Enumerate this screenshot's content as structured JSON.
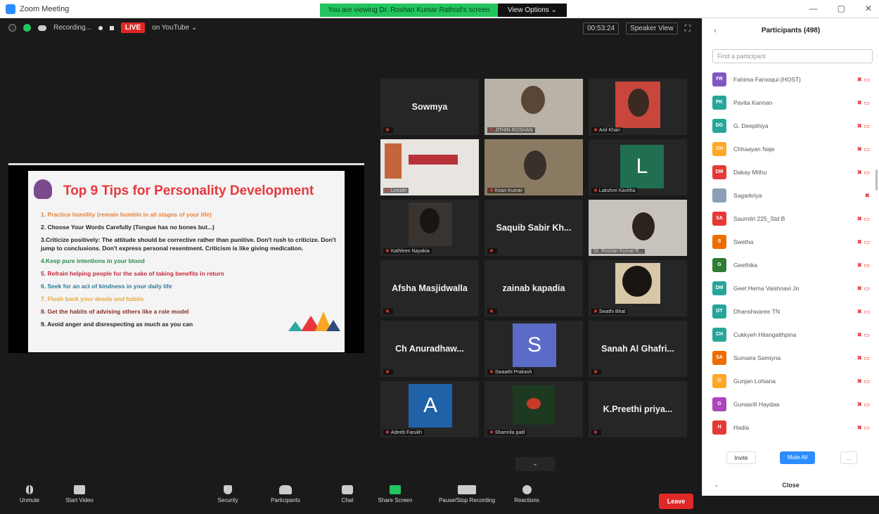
{
  "window": {
    "title": "Zoom Meeting",
    "banner": "You are viewing Dr. Roshan Kumar Rathod's screen",
    "view_options": "View Options ⌄",
    "controls": [
      "—",
      "▢",
      "✕"
    ]
  },
  "topbar": {
    "recording": "Recording...",
    "live": "LIVE",
    "live_on": "on YouTube ⌄",
    "timer": "00:53:24",
    "view": "Speaker View"
  },
  "slide": {
    "title": "Top 9 Tips for Personality Development",
    "items": [
      {
        "text": "1. Practice humility (remain humble in all stages of your life)",
        "color": "#e8833a"
      },
      {
        "text": "2. Choose Your Words Carefully (Tongue has no bones but...)",
        "color": "#222222"
      },
      {
        "text": "3.Criticize positively: The attitude should be corrective rather than punitive. Don't rush to criticize. Don't jump to conclusions. Don't express personal resentment. Criticism is like giving medication.",
        "color": "#222222"
      },
      {
        "text": "4.Keep pure intentions in your blood",
        "color": "#2a8a4a"
      },
      {
        "text": "5. Refrain helping people for the sake of taking benefits in return",
        "color": "#c8283a"
      },
      {
        "text": "6. Seek for an act of kindness in your daily life",
        "color": "#2a7a9a"
      },
      {
        "text": "7. Flush back your deeds and habits",
        "color": "#e8a83a"
      },
      {
        "text": "8. Get the habits of advising others like a role model",
        "color": "#8a2a2a"
      },
      {
        "text": "9. Avoid anger and disrespecting as much as you can",
        "color": "#222222"
      }
    ]
  },
  "tiles": [
    {
      "name": "Sowmya",
      "label": ""
    },
    {
      "name": "",
      "label": "JITHIN ROSHAN"
    },
    {
      "name": "",
      "label": "Anil Khan"
    },
    {
      "name": "",
      "label": "Lincoln"
    },
    {
      "name": "",
      "label": "Kiran Kumar"
    },
    {
      "name": "",
      "label": "Lakshmi Kavitha",
      "letter": "L"
    },
    {
      "name": "",
      "label": "Kathleen Nayakia"
    },
    {
      "name": "Saquib Sabir Kh...",
      "label": ""
    },
    {
      "name": "",
      "label": "Dr. Roshan Kumar R..."
    },
    {
      "name": "Afsha Masjidwalla",
      "label": ""
    },
    {
      "name": "zainab kapadia",
      "label": ""
    },
    {
      "name": "",
      "label": "Swathi Bhat"
    },
    {
      "name": "Ch Anuradhaw...",
      "label": ""
    },
    {
      "name": "",
      "label": "Swaathi Prakash",
      "letter": "S"
    },
    {
      "name": "Sanah Al Ghafri...",
      "label": ""
    },
    {
      "name": "",
      "label": "Adeeb Farukh",
      "letter": "A"
    },
    {
      "name": "",
      "label": "Sharmila patil"
    },
    {
      "name": "K.Preethi priya...",
      "label": ""
    }
  ],
  "more_arrow": "⌄",
  "toolbar": [
    {
      "label": "Unmute",
      "icon": "mic-icon"
    },
    {
      "label": "Start Video",
      "icon": "video-icon"
    },
    {
      "label": "Security",
      "icon": "shield-icon"
    },
    {
      "label": "Participants",
      "icon": "participants-icon",
      "count": "498"
    },
    {
      "label": "Chat",
      "icon": "chat-icon"
    },
    {
      "label": "Share Screen",
      "icon": "share-icon"
    },
    {
      "label": "Pause/Stop Recording",
      "icon": "record-icon"
    },
    {
      "label": "Reactions",
      "icon": "reactions-icon"
    }
  ],
  "leave": "Leave",
  "panel": {
    "title": "Participants (498)",
    "search_placeholder": "Find a participant",
    "participants": [
      {
        "initials": "FR",
        "name": "Fahima Farooqui (HOST)",
        "color": "#7e57c2"
      },
      {
        "initials": "PK",
        "name": "Pavita Kannan",
        "color": "#26a69a"
      },
      {
        "initials": "DG",
        "name": "G. Deepthiya",
        "color": "#26a69a"
      },
      {
        "initials": "CH",
        "name": "Chhaayan Naje",
        "color": "#ffa726"
      },
      {
        "initials": "DM",
        "name": "Dakay Mithu",
        "color": "#e53935"
      },
      {
        "initials": "",
        "name": "Sagarkriya",
        "color": "#8aa0b8"
      },
      {
        "initials": "SA",
        "name": "Saumitri 225_Std B",
        "color": "#e53935"
      },
      {
        "initials": "S",
        "name": "Swetha",
        "color": "#ef6c00"
      },
      {
        "initials": "G",
        "name": "Geethika",
        "color": "#2e7d32"
      },
      {
        "initials": "DM",
        "name": "Geet Hema Vaishnavi Jo",
        "color": "#26a69a"
      },
      {
        "initials": "DT",
        "name": "Dhanshwaree TN",
        "color": "#26a69a"
      },
      {
        "initials": "CH",
        "name": "Cukkyeh Hilangalthpina",
        "color": "#26a69a"
      },
      {
        "initials": "SA",
        "name": "Sumaira Samiyna",
        "color": "#ef6c00"
      },
      {
        "initials": "G",
        "name": "Gunjan Lohiana",
        "color": "#ffa726"
      },
      {
        "initials": "G",
        "name": "Gunasrili Haydaa",
        "color": "#ab47bc"
      },
      {
        "initials": "H",
        "name": "Hadia",
        "color": "#e53935"
      }
    ],
    "invite": "Invite",
    "mute_all": "Mute All",
    "more": "...",
    "close": "Close"
  }
}
